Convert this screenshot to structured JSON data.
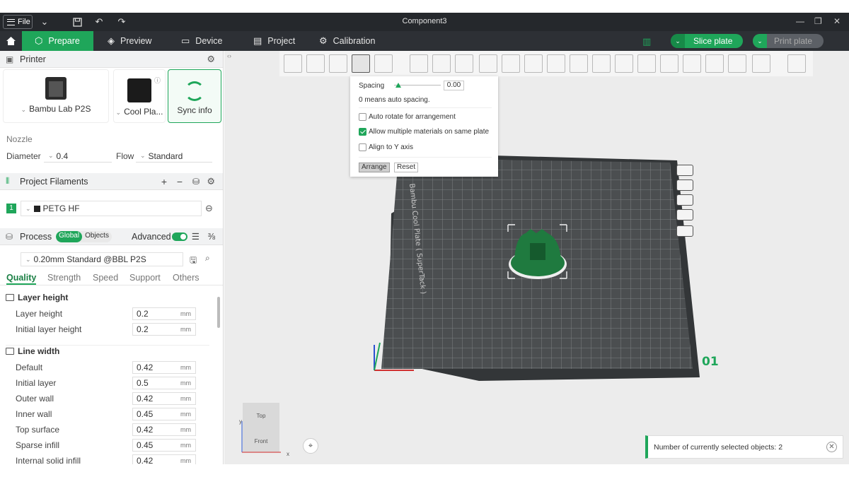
{
  "app": {
    "window_title": "Component3",
    "file_menu_label": "File"
  },
  "tabs": [
    {
      "label": "Prepare",
      "active": true
    },
    {
      "label": "Preview",
      "active": false
    },
    {
      "label": "Device",
      "active": false
    },
    {
      "label": "Project",
      "active": false
    },
    {
      "label": "Calibration",
      "active": false
    }
  ],
  "actions": {
    "slice_plate": "Slice plate",
    "print_plate": "Print plate"
  },
  "colors": {
    "accent": "#1fa65a",
    "titlebar": "#25282c",
    "tabbar": "#2d3035",
    "model": "#1f7a3f"
  },
  "printer": {
    "section_title": "Printer",
    "printer_name": "Bambu Lab P2S",
    "plate_name": "Cool Pla...",
    "sync_label": "Sync info",
    "nozzle_label": "Nozzle",
    "diameter_label": "Diameter",
    "diameter_value": "0.4",
    "flow_label": "Flow",
    "flow_value": "Standard"
  },
  "filaments": {
    "section_title": "Project Filaments",
    "items": [
      {
        "index": "1",
        "name": "PETG HF"
      }
    ]
  },
  "process": {
    "section_title": "Process",
    "toggle_global": "Global",
    "toggle_objects": "Objects",
    "advanced_label": "Advanced",
    "advanced_on": true,
    "preset": "0.20mm Standard @BBL P2S",
    "subtabs": [
      {
        "label": "Quality",
        "active": true
      },
      {
        "label": "Strength",
        "active": false
      },
      {
        "label": "Speed",
        "active": false
      },
      {
        "label": "Support",
        "active": false
      },
      {
        "label": "Others",
        "active": false
      }
    ],
    "groups": [
      {
        "title": "Layer height",
        "rows": [
          {
            "label": "Layer height",
            "value": "0.2",
            "unit": "mm"
          },
          {
            "label": "Initial layer height",
            "value": "0.2",
            "unit": "mm"
          }
        ]
      },
      {
        "title": "Line width",
        "rows": [
          {
            "label": "Default",
            "value": "0.42",
            "unit": "mm"
          },
          {
            "label": "Initial layer",
            "value": "0.5",
            "unit": "mm"
          },
          {
            "label": "Outer wall",
            "value": "0.42",
            "unit": "mm"
          },
          {
            "label": "Inner wall",
            "value": "0.45",
            "unit": "mm"
          },
          {
            "label": "Top surface",
            "value": "0.42",
            "unit": "mm"
          },
          {
            "label": "Sparse infill",
            "value": "0.45",
            "unit": "mm"
          },
          {
            "label": "Internal solid infill",
            "value": "0.42",
            "unit": "mm"
          }
        ]
      }
    ]
  },
  "arrange_popup": {
    "spacing_label": "Spacing",
    "spacing_value": "0.00",
    "spacing_note": "0 means auto spacing.",
    "options": [
      {
        "label": "Auto rotate for arrangement",
        "checked": false
      },
      {
        "label": "Allow multiple materials on same plate",
        "checked": true
      },
      {
        "label": "Align to Y axis",
        "checked": false
      }
    ],
    "arrange_btn": "Arrange",
    "reset_btn": "Reset"
  },
  "viewport": {
    "plate_label": "Bambu Cool Plate ( SuperTack )",
    "plate_number": "01",
    "view_top": "Top",
    "view_front": "Front",
    "axis_x": "x",
    "axis_y": "y",
    "status_text": "Number of currently selected objects: 2"
  }
}
